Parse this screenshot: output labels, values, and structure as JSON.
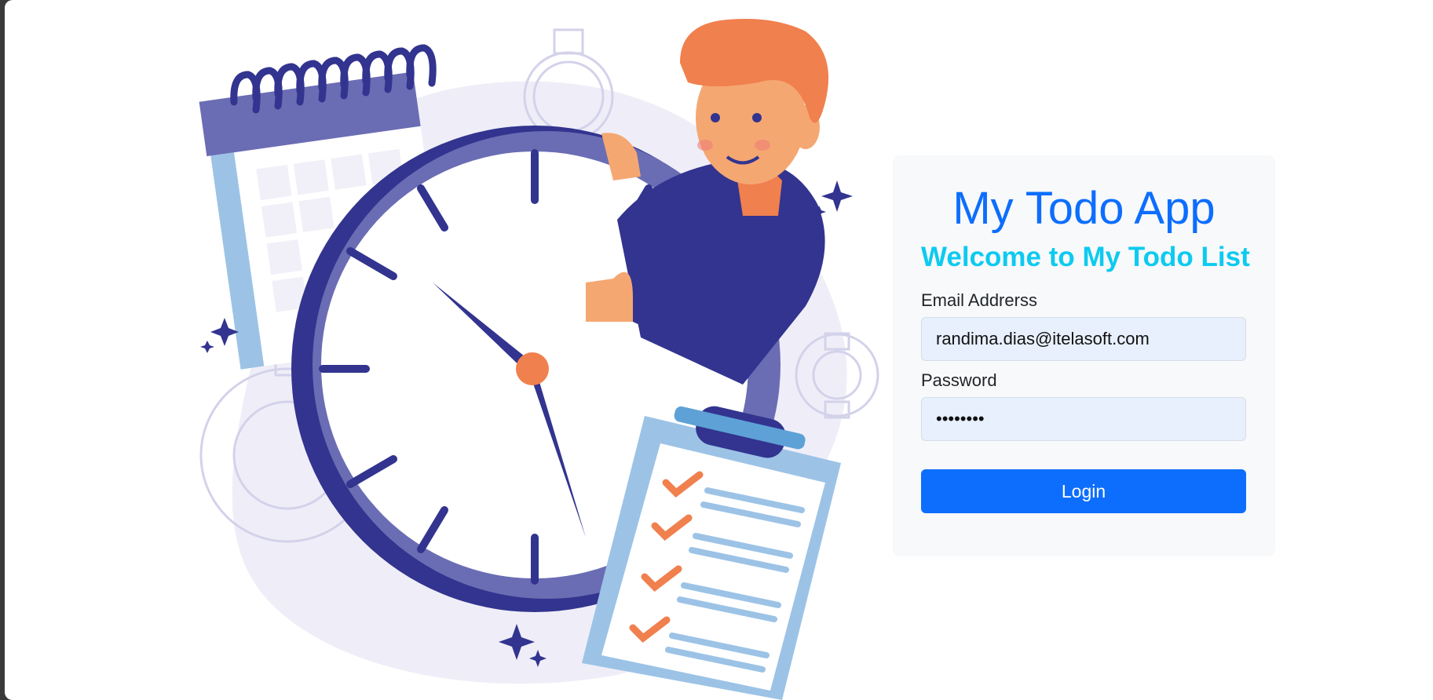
{
  "login": {
    "title": "My Todo App",
    "subtitle": "Welcome to My Todo List",
    "email_label": "Email Addrerss",
    "email_value": "randima.dias@itelasoft.com",
    "password_label": "Password",
    "password_value": "password",
    "button_label": "Login"
  },
  "colors": {
    "primary": "#0d6efd",
    "info": "#0dcaf0",
    "card_bg": "#f8f9fa",
    "input_bg": "#e8f0fe",
    "illustration_navy": "#32348f",
    "illustration_purple": "#6a6db3",
    "illustration_orange": "#f0804e",
    "illustration_light_blue": "#9cc3e6"
  }
}
